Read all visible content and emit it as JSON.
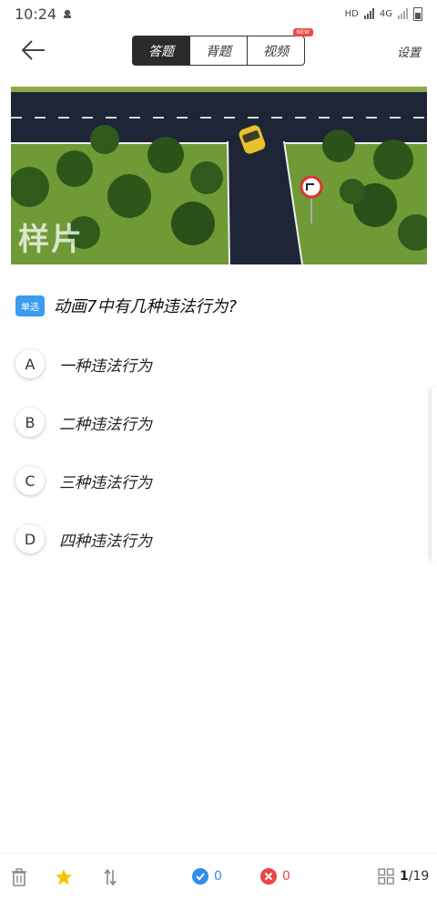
{
  "status_bar": {
    "time": "10:24",
    "network": "HD",
    "net_type": "4G"
  },
  "header": {
    "back_icon": "back-arrow-icon",
    "tabs": [
      {
        "label": "答题",
        "active": true
      },
      {
        "label": "背题",
        "active": false
      },
      {
        "label": "视频",
        "active": false,
        "badge": "NEW"
      }
    ],
    "settings_label": "设置"
  },
  "video": {
    "watermark": "样片"
  },
  "question": {
    "type_tag": "单选",
    "text": "动画7中有几种违法行为?",
    "options": [
      {
        "letter": "A",
        "text": "一种违法行为"
      },
      {
        "letter": "B",
        "text": "二种违法行为"
      },
      {
        "letter": "C",
        "text": "三种违法行为"
      },
      {
        "letter": "D",
        "text": "四种违法行为"
      }
    ]
  },
  "bottom_bar": {
    "correct_count": "0",
    "wrong_count": "0",
    "page_current": "1",
    "page_total": "/19"
  },
  "colors": {
    "accent": "#3c9bf0",
    "correct": "#2f8ee8",
    "wrong": "#ee4444",
    "star": "#f5c400"
  }
}
